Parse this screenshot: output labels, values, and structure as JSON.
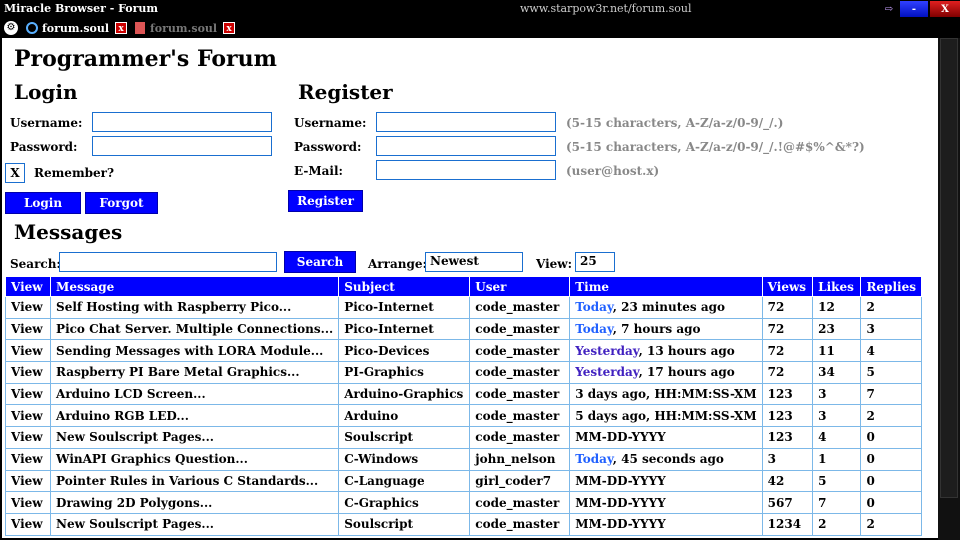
{
  "window": {
    "title": "Miracle Browser - Forum",
    "url": "www.starpow3r.net/forum.soul",
    "min_label": "-",
    "close_label": "X"
  },
  "tabs": [
    {
      "label": "forum.soul",
      "close": "x",
      "active": true
    },
    {
      "label": "forum.soul",
      "close": "x",
      "active": false
    }
  ],
  "page": {
    "title": "Programmer's Forum"
  },
  "login": {
    "heading": "Login",
    "username_label": "Username:",
    "password_label": "Password:",
    "remember_label": "Remember?",
    "remember_mark": "X",
    "login_button": "Login",
    "forgot_button": "Forgot"
  },
  "register": {
    "heading": "Register",
    "username_label": "Username:",
    "password_label": "Password:",
    "email_label": "E-Mail:",
    "username_hint": "(5-15 characters, A-Z/a-z/0-9/_/.)",
    "password_hint": "(5-15 characters, A-Z/a-z/0-9/_/.!@#$%^&*?)",
    "email_hint": "(user@host.x)",
    "register_button": "Register"
  },
  "messages": {
    "heading": "Messages",
    "search_label": "Search:",
    "search_button": "Search",
    "arrange_label": "Arrange:",
    "arrange_value": "Newest",
    "view_label": "View:",
    "view_value": "25",
    "columns": [
      "View",
      "Message",
      "Subject",
      "User",
      "Time",
      "Views",
      "Likes",
      "Replies"
    ],
    "rows": [
      {
        "view": "View",
        "message": "Self Hosting with Raspberry Pico...",
        "subject": "Pico-Internet",
        "user": "code_master",
        "time_day": "Today",
        "time_rest": ", 23 minutes ago",
        "views": "72",
        "likes": "12",
        "replies": "2"
      },
      {
        "view": "View",
        "message": "Pico Chat Server. Multiple Connections...",
        "subject": "Pico-Internet",
        "user": "code_master",
        "time_day": "Today",
        "time_rest": ", 7 hours ago",
        "views": "72",
        "likes": "23",
        "replies": "3"
      },
      {
        "view": "View",
        "message": "Sending Messages with LORA Module...",
        "subject": "Pico-Devices",
        "user": "code_master",
        "time_day": "Yesterday",
        "time_rest": ", 13 hours ago",
        "views": "72",
        "likes": "11",
        "replies": "4"
      },
      {
        "view": "View",
        "message": "Raspberry PI Bare Metal Graphics...",
        "subject": "PI-Graphics",
        "user": "code_master",
        "time_day": "Yesterday",
        "time_rest": ", 17 hours ago",
        "views": "72",
        "likes": "34",
        "replies": "5"
      },
      {
        "view": "View",
        "message": "Arduino LCD Screen...",
        "subject": "Arduino-Graphics",
        "user": "code_master",
        "time_day": "",
        "time_rest": "3 days ago, HH:MM:SS-XM",
        "views": "123",
        "likes": "3",
        "replies": "7"
      },
      {
        "view": "View",
        "message": "Arduino RGB LED...",
        "subject": "Arduino",
        "user": "code_master",
        "time_day": "",
        "time_rest": "5 days ago, HH:MM:SS-XM",
        "views": "123",
        "likes": "3",
        "replies": "2"
      },
      {
        "view": "View",
        "message": "New Soulscript Pages...",
        "subject": "Soulscript",
        "user": "code_master",
        "time_day": "",
        "time_rest": "MM-DD-YYYY",
        "views": "123",
        "likes": "4",
        "replies": "0"
      },
      {
        "view": "View",
        "message": "WinAPI Graphics Question...",
        "subject": "C-Windows",
        "user": "john_nelson",
        "time_day": "Today",
        "time_rest": ", 45 seconds ago",
        "views": "3",
        "likes": "1",
        "replies": "0"
      },
      {
        "view": "View",
        "message": "Pointer Rules in Various C Standards...",
        "subject": "C-Language",
        "user": "girl_coder7",
        "time_day": "",
        "time_rest": "MM-DD-YYYY",
        "views": "42",
        "likes": "5",
        "replies": "0"
      },
      {
        "view": "View",
        "message": "Drawing 2D Polygons...",
        "subject": "C-Graphics",
        "user": "code_master",
        "time_day": "",
        "time_rest": "MM-DD-YYYY",
        "views": "567",
        "likes": "7",
        "replies": "0"
      },
      {
        "view": "View",
        "message": "New Soulscript Pages...",
        "subject": "Soulscript",
        "user": "code_master",
        "time_day": "",
        "time_rest": "MM-DD-YYYY",
        "views": "1234",
        "likes": "2",
        "replies": "2"
      }
    ]
  }
}
